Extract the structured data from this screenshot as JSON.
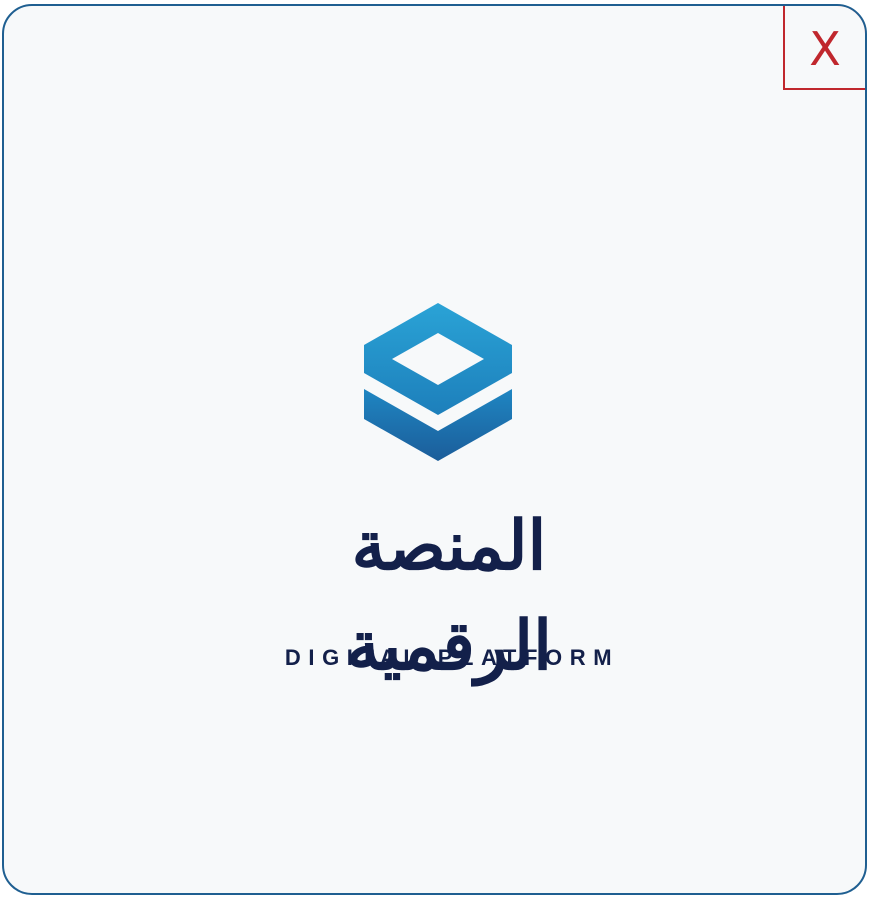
{
  "dialog": {
    "close_label": "X",
    "colors": {
      "border": "#1f5f91",
      "background": "#f7f9fa",
      "close": "#c0272d"
    }
  },
  "logo": {
    "icon": "layered-cube-icon",
    "arabic_name": "المنصة الرقمية",
    "english_name": "DIGITAL PLATFORM",
    "colors": {
      "mark_light": "#2196c9",
      "mark_dark": "#1b5d9a",
      "text": "#13204a"
    }
  }
}
